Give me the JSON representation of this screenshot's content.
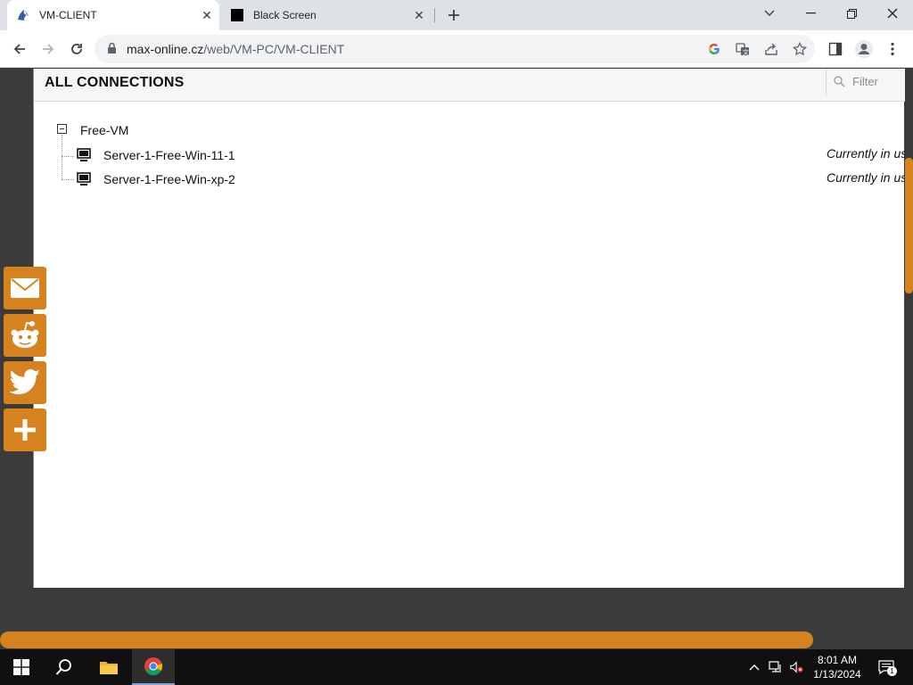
{
  "browser": {
    "tabs": [
      {
        "title": "VM-CLIENT",
        "icon": "vm-client-favicon",
        "active": true
      },
      {
        "title": "Black Screen",
        "icon": "black-square-favicon",
        "active": false
      }
    ],
    "url_host": "max-online.cz",
    "url_path": "/web/VM-PC/VM-CLIENT"
  },
  "page": {
    "header_title": "ALL CONNECTIONS",
    "filter_placeholder": "Filter",
    "group": {
      "name": "Free-VM",
      "connections": [
        {
          "name": "Server-1-Free-Win-11-1",
          "status": "Currently in use"
        },
        {
          "name": "Server-1-Free-Win-xp-2",
          "status": "Currently in use"
        }
      ]
    },
    "share_buttons": [
      "email-icon",
      "reddit-icon",
      "twitter-icon",
      "plus-icon"
    ],
    "accent_color": "#d6821f"
  },
  "taskbar": {
    "time": "8:01 AM",
    "date": "1/13/2024",
    "notification_count": "1"
  }
}
